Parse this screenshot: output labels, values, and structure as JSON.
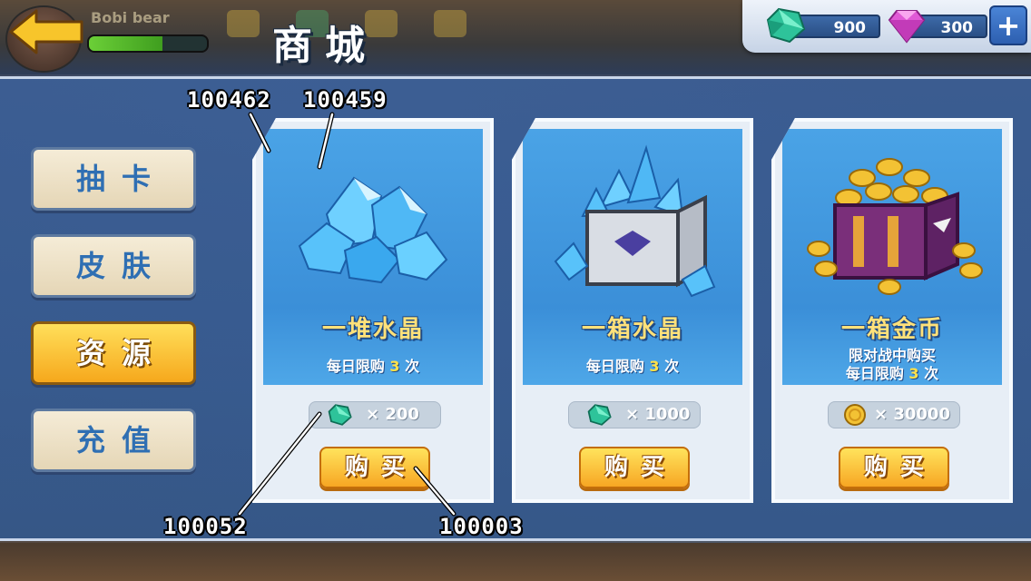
{
  "header": {
    "title": "商城",
    "player_name": "Bobi bear",
    "exp_fraction": 0.62
  },
  "currency": {
    "crystal": "900",
    "diamond": "300",
    "plus": "+"
  },
  "tabs": [
    {
      "label": "抽卡",
      "active": false
    },
    {
      "label": "皮肤",
      "active": false
    },
    {
      "label": "资源",
      "active": true
    },
    {
      "label": "充值",
      "active": false
    }
  ],
  "cards": [
    {
      "name": "一堆水晶",
      "desc_lines": [
        [
          "每日限购 ",
          "3",
          " 次"
        ]
      ],
      "price_icon": "crystal-icon",
      "price": "× 200",
      "buy": "购买"
    },
    {
      "name": "一箱水晶",
      "desc_lines": [
        [
          "每日限购 ",
          "3",
          " 次"
        ]
      ],
      "price_icon": "crystal-icon",
      "price": "× 1000",
      "buy": "购买"
    },
    {
      "name": "一箱金币",
      "desc_lines": [
        [
          "限对战中购买",
          "",
          ""
        ],
        [
          "每日限购 ",
          "3",
          " 次"
        ]
      ],
      "price_icon": "coin-icon",
      "price": "× 30000",
      "buy": "购买"
    }
  ],
  "debug_labels": {
    "l1": "100462",
    "l2": "100459",
    "l3": "100052",
    "l4": "100003"
  },
  "colors": {
    "accent": "#f7a623",
    "tab_text": "#2f6fb3",
    "highlight": "#ffe14a"
  }
}
